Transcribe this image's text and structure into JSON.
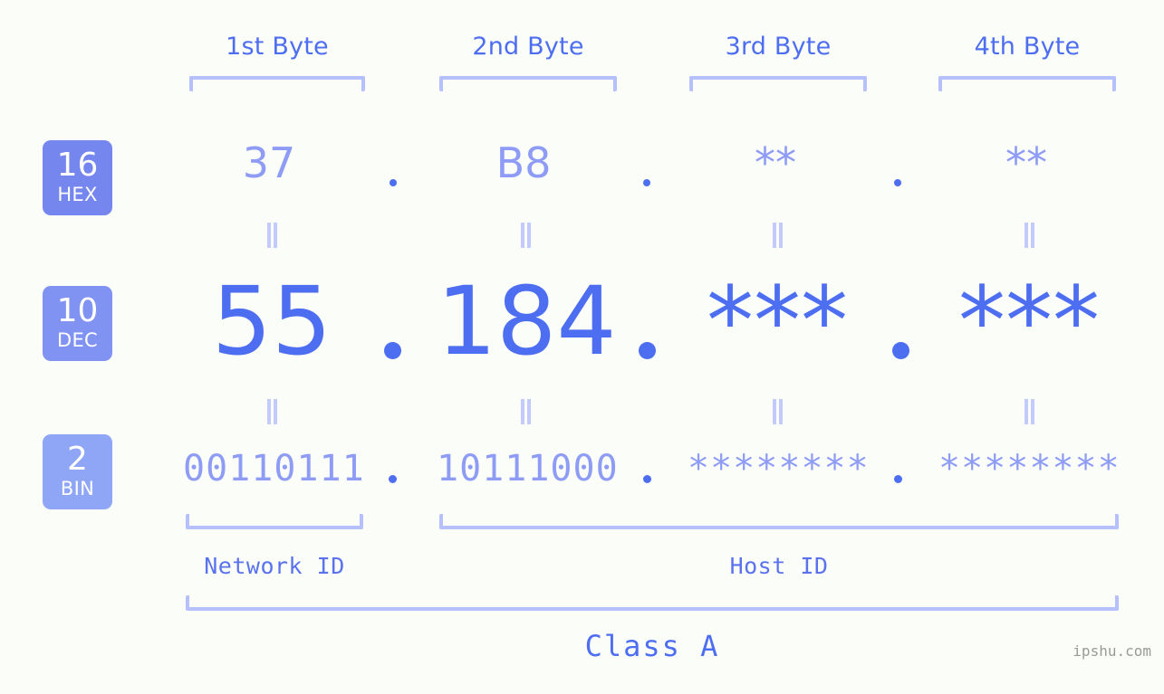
{
  "page": {
    "background_color": "#fbfdf9",
    "accent_color": "#4e6ef2",
    "accent_light_color": "#8e9cf5",
    "bracket_color": "#b6c0fb",
    "watermark": "ipshu.com"
  },
  "byte_headers": [
    {
      "label": "1st Byte"
    },
    {
      "label": "2nd Byte"
    },
    {
      "label": "3rd Byte"
    },
    {
      "label": "4th Byte"
    }
  ],
  "rows": [
    {
      "badge_base": "16",
      "badge_name": "HEX",
      "badge_color": "#7586ee",
      "values": [
        "37",
        "B8",
        "**",
        "**"
      ],
      "separator": "."
    },
    {
      "badge_base": "10",
      "badge_name": "DEC",
      "badge_color": "#8193f2",
      "values": [
        "55",
        "184",
        "***",
        "***"
      ],
      "separator": "."
    },
    {
      "badge_base": "2",
      "badge_name": "BIN",
      "badge_color": "#8fa6f7",
      "values": [
        "00110111",
        "10111000",
        "********",
        "********"
      ],
      "separator": "."
    }
  ],
  "equals_separator": "=",
  "sections": [
    {
      "label": "Network ID"
    },
    {
      "label": "Host ID"
    }
  ],
  "class": {
    "label": "Class A"
  }
}
